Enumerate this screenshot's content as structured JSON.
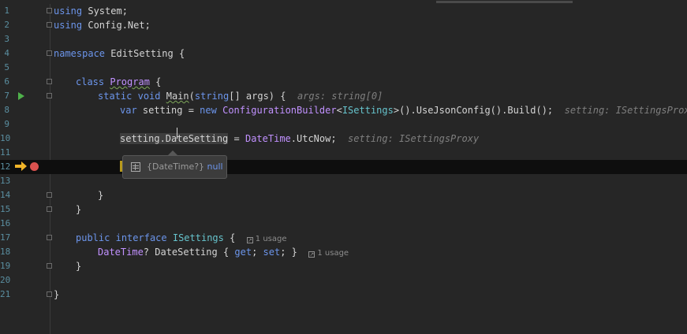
{
  "editor": {
    "line_numbers": [
      "1",
      "2",
      "3",
      "4",
      "5",
      "6",
      "7",
      "8",
      "9",
      "10",
      "11",
      "12",
      "13",
      "14",
      "15",
      "16",
      "17",
      "18",
      "19",
      "20",
      "21"
    ],
    "lines": {
      "l1_kw": "using",
      "l1_rest": " System;",
      "l2_kw": "using",
      "l2_rest": " Config.Net;",
      "l4_kw": "namespace",
      "l4_rest": " EditSetting {",
      "l6_kw": "class",
      "l6_sp": " ",
      "l6_cls": "Program",
      "l6_rest": " {",
      "l7_kw1": "static",
      "l7_sp1": " ",
      "l7_kw2": "void",
      "l7_sp2": " ",
      "l7_main": "Main",
      "l7_p1": "(",
      "l7_kw3": "string",
      "l7_p2": "[] args) {",
      "l7_hint": "args: string[0]",
      "l8_kw1": "var",
      "l8_a": " setting = ",
      "l8_kw2": "new",
      "l8_sp": " ",
      "l8_cls": "ConfigurationBuilder",
      "l8_lt": "<",
      "l8_iface": "ISettings",
      "l8_rest": ">().UseJsonConfig().Build();",
      "l8_hint": "setting: ISettingsProxy",
      "l10_sel": "setting.DateSetting",
      "l10_eq": " = ",
      "l10_type": "DateTime",
      "l10_rest": ".UtcNow;",
      "l10_hint": "setting: ISettingsProxy",
      "l14_text": "}",
      "l15_text": "}",
      "l17_kw1": "public",
      "l17_sp1": " ",
      "l17_kw2": "interface",
      "l17_sp2": " ",
      "l17_iface": "ISettings",
      "l17_rest": " {",
      "l17_usage": "1 usage",
      "l18_type": "DateTime",
      "l18_a": "? DateSetting { ",
      "l18_kw1": "get",
      "l18_b": "; ",
      "l18_kw2": "set",
      "l18_c": "; }",
      "l18_usage": "1 usage",
      "l19_text": "}",
      "l21_text": "}"
    }
  },
  "tooltip": {
    "type_label": "{DateTime?}",
    "value": "null"
  },
  "colors": {
    "keyword": "#6c95eb",
    "class": "#c191ff",
    "interface": "#66c3cc",
    "background": "#262626",
    "current_line": "#0e0e0e"
  },
  "icons": {
    "run": "run-gutter-icon",
    "execution_pointer": "execution-arrow-icon",
    "breakpoint": "breakpoint-icon",
    "tooltip": "table-icon",
    "usage": "usage-link-icon"
  }
}
